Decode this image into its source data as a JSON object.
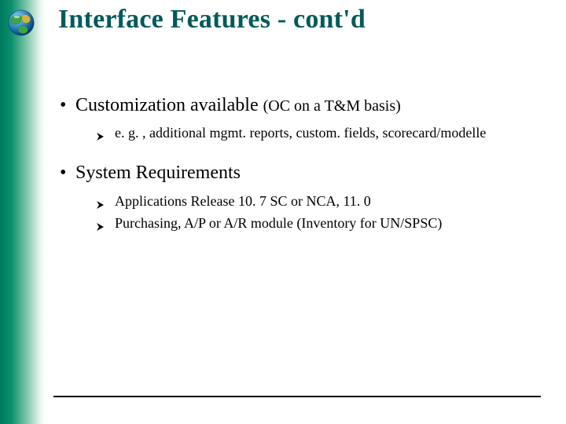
{
  "title": "Interface Features - cont'd",
  "bullets": [
    {
      "text": "Customization available",
      "paren": "(OC on a T&M basis)",
      "sub": [
        "e. g. , additional mgmt. reports, custom. fields, scorecard/modelle"
      ]
    },
    {
      "text": "System Requirements",
      "paren": "",
      "sub": [
        "Applications Release 10. 7 SC or NCA, 11. 0",
        "Purchasing, A/P or A/R module (Inventory for UN/SPSC)"
      ]
    }
  ]
}
